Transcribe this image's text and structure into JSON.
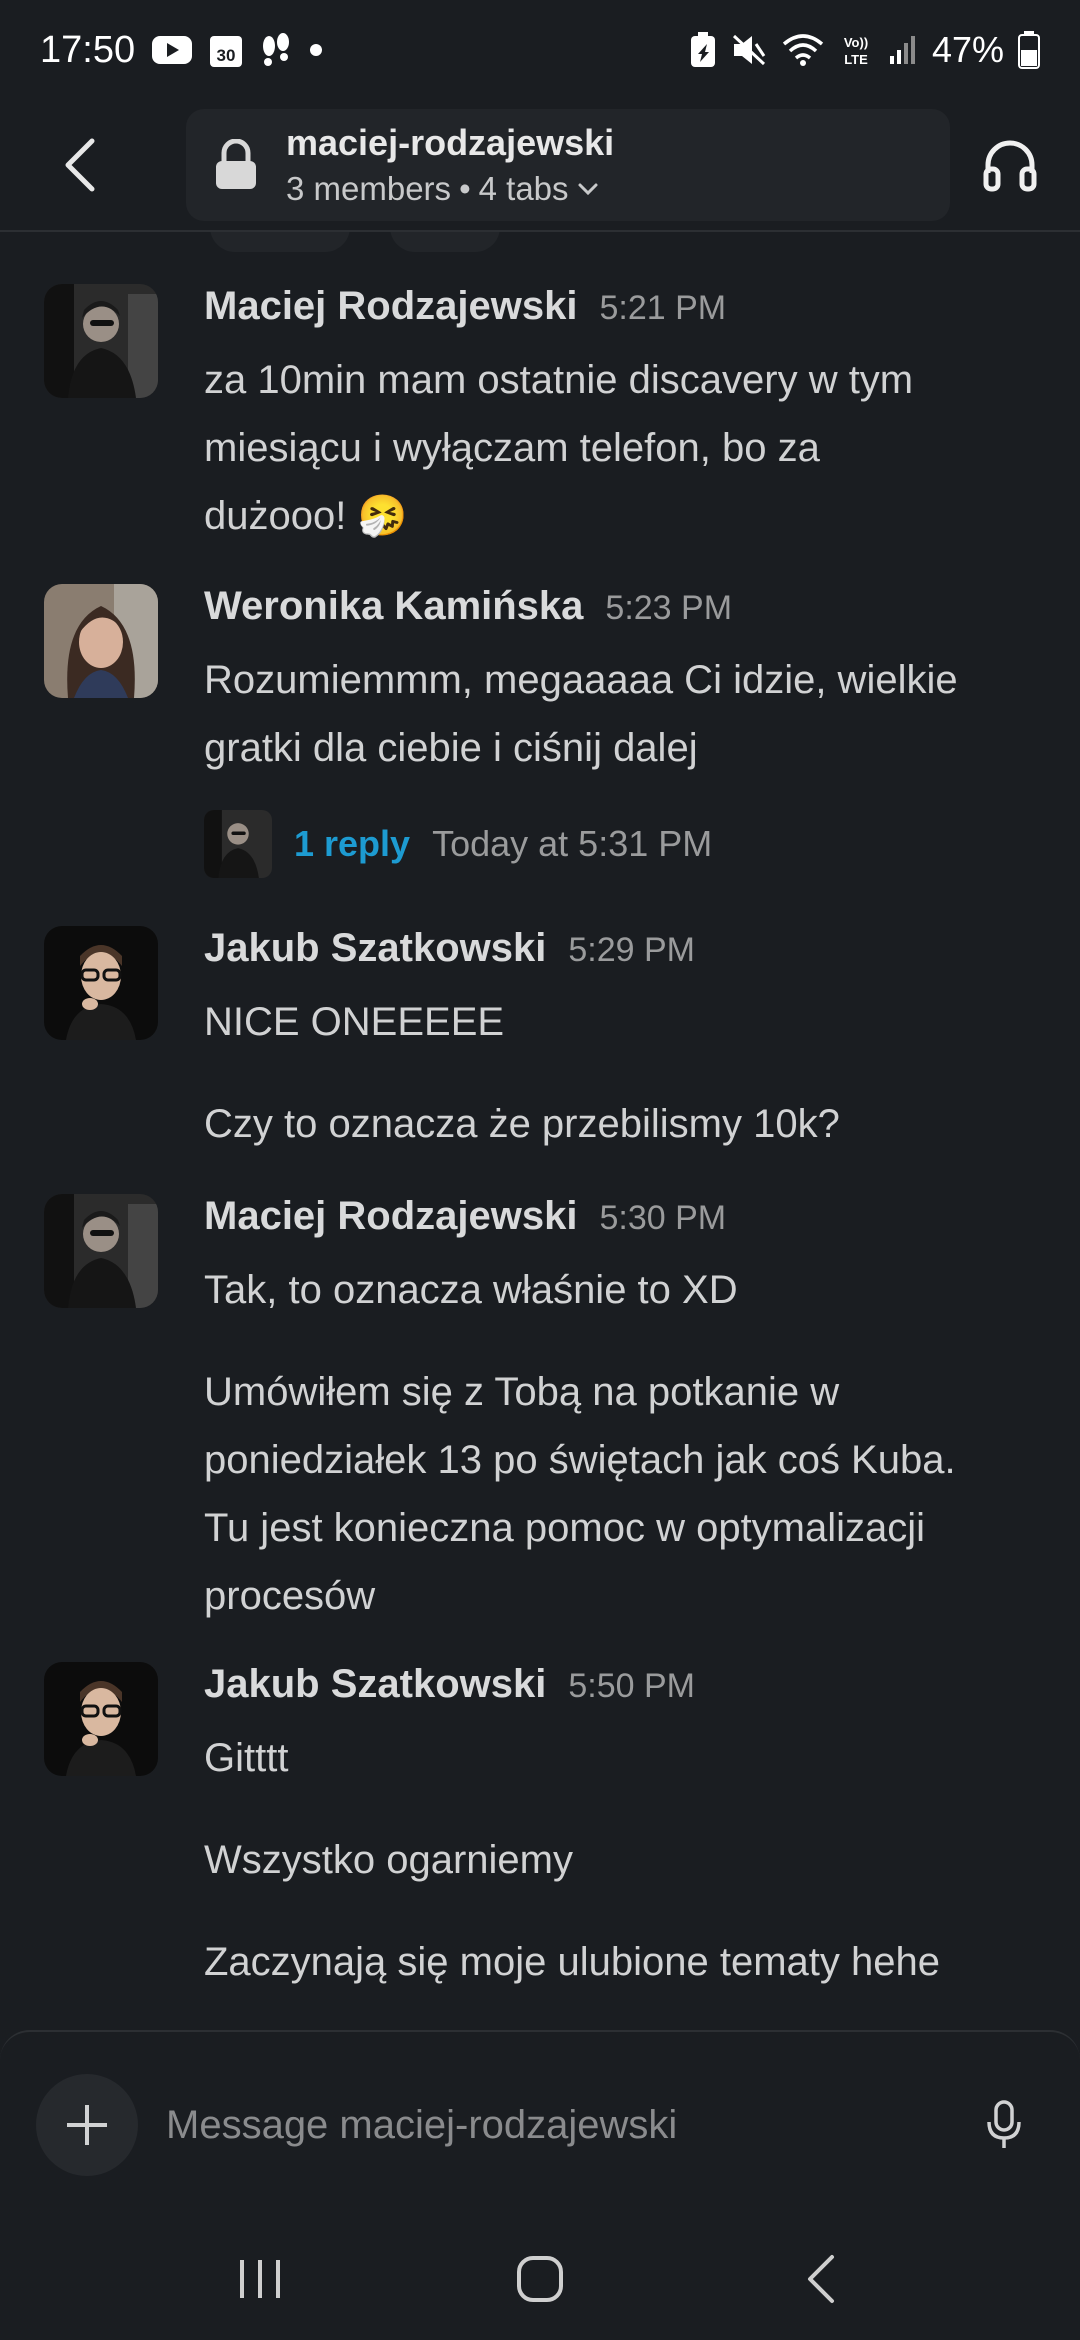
{
  "status_bar": {
    "time": "17:50",
    "battery": "47%",
    "calendar_day": "30",
    "icons": [
      "youtube-icon",
      "calendar-icon",
      "steps-icon",
      "dot-icon",
      "battery-saver-icon",
      "mute-icon",
      "wifi-icon",
      "volte-icon",
      "signal-icon",
      "battery-icon"
    ]
  },
  "header": {
    "channel_name": "maciej-rodzajewski",
    "members": "3 members",
    "separator": "•",
    "tabs": "4 tabs"
  },
  "colors": {
    "background": "#1a1d21",
    "link": "#1d9bd1",
    "muted": "#9a9b9c"
  },
  "messages": [
    {
      "author": "Maciej Rodzajewski",
      "time": "5:21 PM",
      "lines": [
        "za 10min mam ostatnie discavery w tym",
        "miesiącu i wyłączam telefon, bo za",
        "dużooo! 🤧"
      ]
    },
    {
      "author": "Weronika Kamińska",
      "time": "5:23 PM",
      "lines": [
        "Rozumiemmm, megaaaaa Ci idzie, wielkie",
        "gratki dla ciebie i ciśnij dalej"
      ],
      "thread": {
        "replies": "1 reply",
        "last_reply": "Today at 5:31 PM"
      }
    },
    {
      "author": "Jakub Szatkowski",
      "time": "5:29 PM",
      "paragraphs": [
        [
          "NICE ONEEEEE"
        ],
        [
          "Czy to oznacza że przebilismy 10k?"
        ]
      ]
    },
    {
      "author": "Maciej Rodzajewski",
      "time": "5:30 PM",
      "paragraphs": [
        [
          "Tak, to oznacza właśnie to XD"
        ],
        [
          "Umówiłem się z Tobą na potkanie w",
          "poniedziałek 13 po świętach jak coś Kuba.",
          "Tu jest konieczna pomoc w optymalizacji",
          "procesów"
        ]
      ]
    },
    {
      "author": "Jakub Szatkowski",
      "time": "5:50 PM",
      "paragraphs": [
        [
          "Gitttt"
        ],
        [
          "Wszystko ogarniemy"
        ],
        [
          "Zaczynają się moje ulubione tematy hehe"
        ]
      ]
    }
  ],
  "composer": {
    "placeholder": "Message maciej-rodzajewski"
  }
}
